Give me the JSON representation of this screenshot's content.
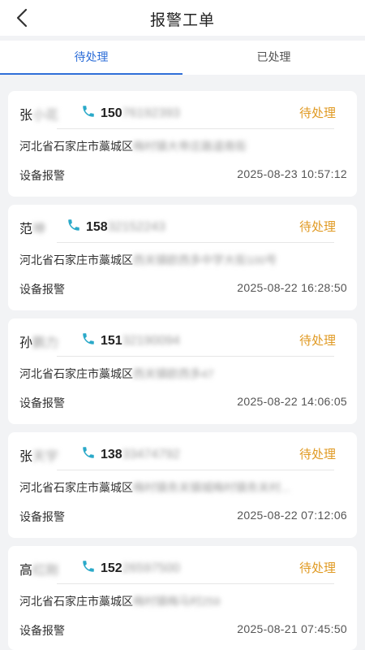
{
  "header": {
    "title": "报警工单"
  },
  "tabs": [
    {
      "label": "待处理",
      "active": true
    },
    {
      "label": "已处理",
      "active": false
    }
  ],
  "colors": {
    "accent": "#2f6fd8",
    "status_pending": "#e09a23",
    "phone_icon": "#2aa9c9"
  },
  "orders": [
    {
      "name": "张",
      "name_masked": "小花",
      "phone": "150",
      "phone_masked": "76192393",
      "status": "待处理",
      "address": "河北省石家庄市藁城区",
      "address_masked": "梅村镇大帝庄路道南街",
      "type": "设备报警",
      "time": "2025-08-23 10:57:12"
    },
    {
      "name": "范",
      "name_masked": "坤",
      "phone": "158",
      "phone_masked": "32152243",
      "status": "待处理",
      "address": "河北省石家庄市藁城区",
      "address_masked": "西关镇欧西多中学大街100号",
      "type": "设备报警",
      "time": "2025-08-22 16:28:50"
    },
    {
      "name": "孙",
      "name_masked": "鹏力",
      "phone": "151",
      "phone_masked": "32190094",
      "status": "待处理",
      "address": "河北省石家庄市藁城区",
      "address_masked": "西关镇欧西多47",
      "type": "设备报警",
      "time": "2025-08-22 14:06:05"
    },
    {
      "name": "张",
      "name_masked": "天宇",
      "phone": "138",
      "phone_masked": "33474792",
      "status": "待处理",
      "address": "河北省石家庄市藁城区",
      "address_masked": "梅村镇务关镇城梅村镇务关村...",
      "type": "设备报警",
      "time": "2025-08-22 07:12:06"
    },
    {
      "name": "高",
      "name_masked": "红刚",
      "phone": "152",
      "phone_masked": "26597500",
      "status": "待处理",
      "address": "河北省石家庄市藁城区",
      "address_masked": "梅村镇梅马村259",
      "type": "设备报警",
      "time": "2025-08-21 07:45:50"
    }
  ]
}
